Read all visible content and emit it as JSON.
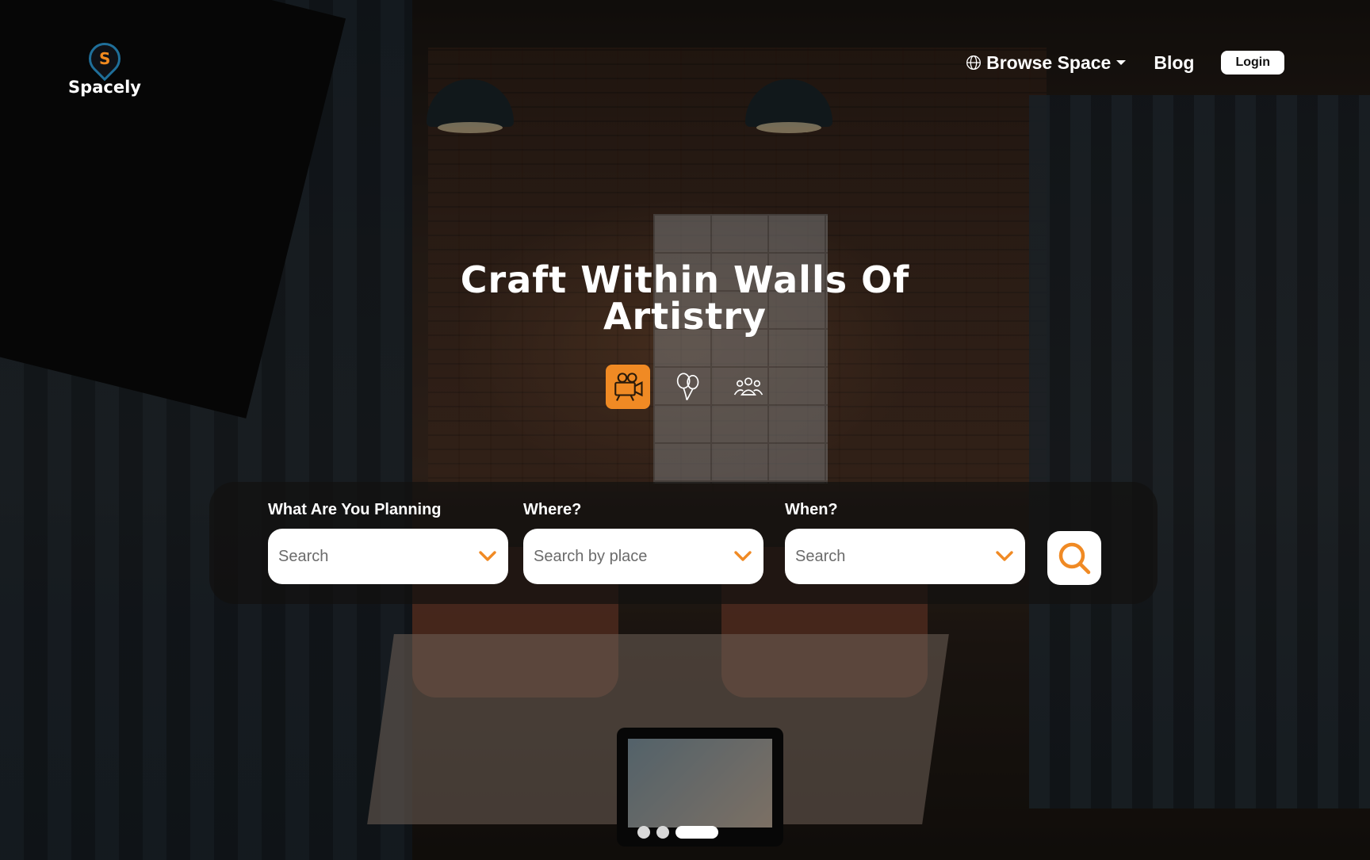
{
  "brand": {
    "name": "Spacely",
    "mark_letter": "S",
    "accent": "#f08a24",
    "ring": "#1f6f9a"
  },
  "nav": {
    "browse_label": "Browse Space",
    "blog_label": "Blog",
    "login_label": "Login"
  },
  "hero": {
    "headline_line1": "Craft Within Walls Of",
    "headline_line2": "Artistry"
  },
  "categories": [
    {
      "icon": "film-camera-icon",
      "active": true
    },
    {
      "icon": "balloons-icon",
      "active": false
    },
    {
      "icon": "people-group-icon",
      "active": false
    }
  ],
  "search": {
    "planning": {
      "label": "What Are You Planning",
      "placeholder": "Search"
    },
    "where": {
      "label": "Where?",
      "placeholder": "Search by place"
    },
    "when": {
      "label": "When?",
      "placeholder": "Search"
    }
  },
  "carousel": {
    "slides": 3,
    "active_index": 2
  }
}
